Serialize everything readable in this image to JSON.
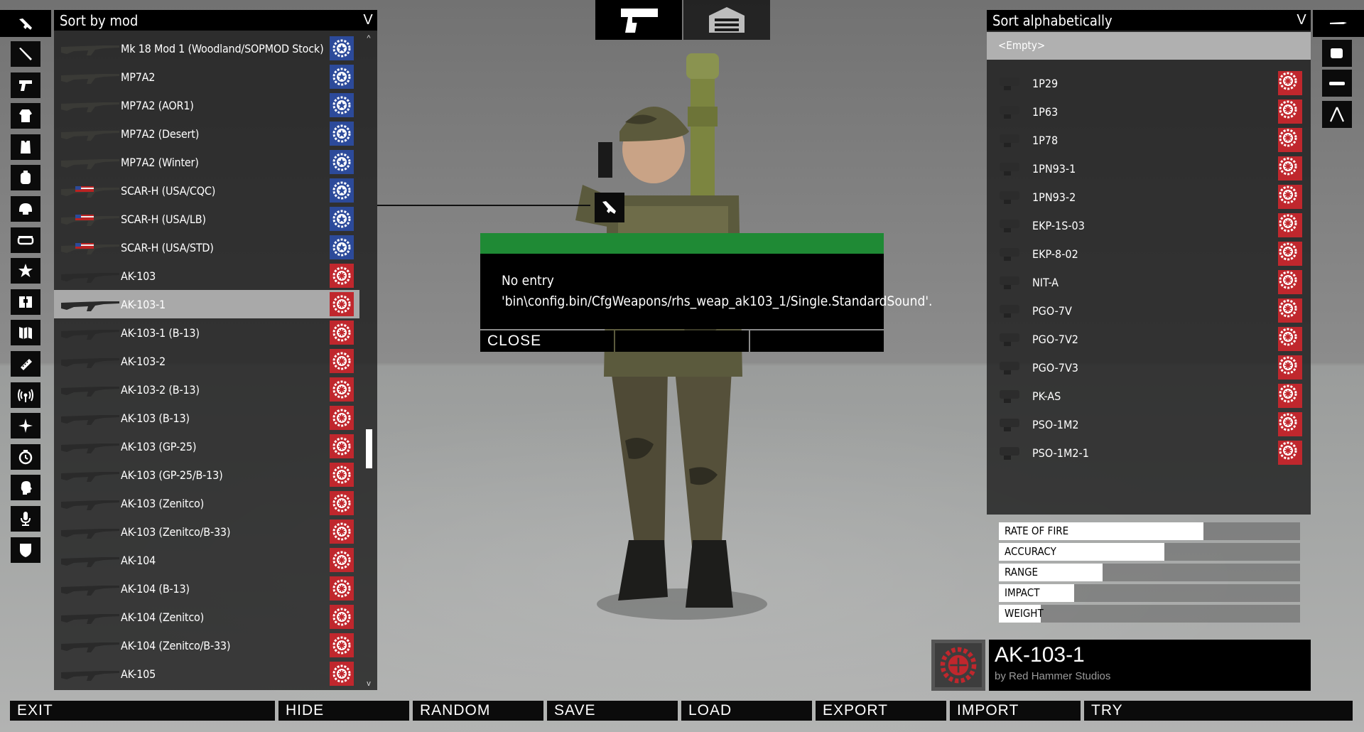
{
  "left_panel": {
    "sort_label": "Sort by mod",
    "chevron": "V",
    "scroll_up": "^",
    "scroll_down": "v",
    "items": [
      {
        "label": "Mk 18 Mod 1 (Woodland/SOPMOD Stock)",
        "mod": "us",
        "selected": false
      },
      {
        "label": "MP7A2",
        "mod": "us",
        "selected": false
      },
      {
        "label": "MP7A2 (AOR1)",
        "mod": "us",
        "selected": false
      },
      {
        "label": "MP7A2 (Desert)",
        "mod": "us",
        "selected": false
      },
      {
        "label": "MP7A2 (Winter)",
        "mod": "us",
        "selected": false
      },
      {
        "label": "SCAR-H (USA/CQC)",
        "mod": "us",
        "selected": false
      },
      {
        "label": "SCAR-H (USA/LB)",
        "mod": "us",
        "selected": false
      },
      {
        "label": "SCAR-H (USA/STD)",
        "mod": "us",
        "selected": false
      },
      {
        "label": "AK-103",
        "mod": "rhs",
        "selected": false
      },
      {
        "label": "AK-103-1",
        "mod": "rhs",
        "selected": true
      },
      {
        "label": "AK-103-1 (B-13)",
        "mod": "rhs",
        "selected": false
      },
      {
        "label": "AK-103-2",
        "mod": "rhs",
        "selected": false
      },
      {
        "label": "AK-103-2 (B-13)",
        "mod": "rhs",
        "selected": false
      },
      {
        "label": "AK-103 (B-13)",
        "mod": "rhs",
        "selected": false
      },
      {
        "label": "AK-103 (GP-25)",
        "mod": "rhs",
        "selected": false
      },
      {
        "label": "AK-103 (GP-25/B-13)",
        "mod": "rhs",
        "selected": false
      },
      {
        "label": "AK-103 (Zenitco)",
        "mod": "rhs",
        "selected": false
      },
      {
        "label": "AK-103 (Zenitco/B-33)",
        "mod": "rhs",
        "selected": false
      },
      {
        "label": "AK-104",
        "mod": "rhs",
        "selected": false
      },
      {
        "label": "AK-104 (B-13)",
        "mod": "rhs",
        "selected": false
      },
      {
        "label": "AK-104 (Zenitco)",
        "mod": "rhs",
        "selected": false
      },
      {
        "label": "AK-104 (Zenitco/B-33)",
        "mod": "rhs",
        "selected": false
      },
      {
        "label": "AK-105",
        "mod": "rhs",
        "selected": false
      }
    ]
  },
  "left_categories": [
    {
      "icon": "primary-weapon-icon",
      "active": true
    },
    {
      "icon": "secondary-weapon-icon",
      "active": false
    },
    {
      "icon": "handgun-icon",
      "active": false
    },
    {
      "icon": "uniform-icon",
      "active": false
    },
    {
      "icon": "vest-icon",
      "active": false
    },
    {
      "icon": "backpack-icon",
      "active": false
    },
    {
      "icon": "helmet-icon",
      "active": false
    },
    {
      "icon": "goggles-icon",
      "active": false
    },
    {
      "icon": "nvg-icon",
      "active": false
    },
    {
      "icon": "binoculars-icon",
      "active": false
    },
    {
      "icon": "map-icon",
      "active": false
    },
    {
      "icon": "gps-icon",
      "active": false
    },
    {
      "icon": "radio-icon",
      "active": false
    },
    {
      "icon": "compass-icon",
      "active": false
    },
    {
      "icon": "watch-icon",
      "active": false
    },
    {
      "icon": "face-icon",
      "active": false
    },
    {
      "icon": "voice-icon",
      "active": false
    },
    {
      "icon": "insignia-icon",
      "active": false
    }
  ],
  "right_categories": [
    {
      "icon": "muzzle-attachment-icon"
    },
    {
      "icon": "optic-attachment-icon"
    },
    {
      "icon": "rail-attachment-icon"
    },
    {
      "icon": "bipod-attachment-icon"
    }
  ],
  "top_tabs": [
    {
      "icon": "weapon-tab-icon",
      "active": true
    },
    {
      "icon": "garage-tab-icon",
      "active": false
    }
  ],
  "dialog": {
    "message": "No entry 'bin\\config.bin/CfgWeapons/rhs_weap_ak103_1/Single.StandardSound'.",
    "close_label": "CLOSE",
    "accent": "#1f8a35"
  },
  "right_panel": {
    "sort_label": "Sort alphabetically",
    "chevron": "V",
    "empty_label": "<Empty>",
    "items": [
      {
        "label": "1P29"
      },
      {
        "label": "1P63"
      },
      {
        "label": "1P78"
      },
      {
        "label": "1PN93-1"
      },
      {
        "label": "1PN93-2"
      },
      {
        "label": "EKP-1S-03"
      },
      {
        "label": "EKP-8-02"
      },
      {
        "label": "NIT-A"
      },
      {
        "label": "PGO-7V"
      },
      {
        "label": "PGO-7V2"
      },
      {
        "label": "PGO-7V3"
      },
      {
        "label": "PK-AS"
      },
      {
        "label": "PSO-1M2"
      },
      {
        "label": "PSO-1M2-1"
      }
    ]
  },
  "stats": [
    {
      "label": "RATE OF FIRE",
      "value": 0.68
    },
    {
      "label": "ACCURACY",
      "value": 0.55
    },
    {
      "label": "RANGE",
      "value": 0.345
    },
    {
      "label": "IMPACT",
      "value": 0.25
    },
    {
      "label": "WEIGHT",
      "value": 0.14
    }
  ],
  "info": {
    "item_name": "AK-103-1",
    "author": "by Red Hammer Studios"
  },
  "bottom_buttons": [
    "EXIT",
    "HIDE",
    "RANDOM",
    "SAVE",
    "LOAD",
    "EXPORT",
    "IMPORT",
    "TRY"
  ],
  "colors": {
    "us_badge": "#2c4a9a",
    "rhs_badge": "#c0272d",
    "selected_row": "#a9a9a9",
    "dialog_bar": "#1f8a35"
  }
}
